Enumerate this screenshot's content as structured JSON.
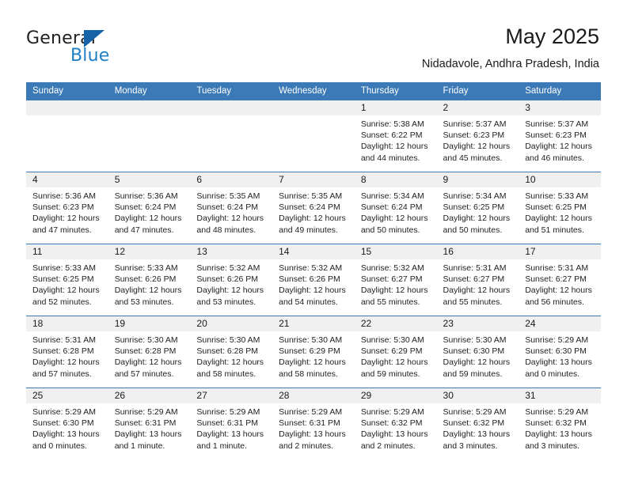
{
  "brand": {
    "line1": "General",
    "line2": "Blue",
    "icon": "triangle-logo"
  },
  "header": {
    "title": "May 2025",
    "subtitle": "Nidadavole, Andhra Pradesh, India"
  },
  "colors": {
    "header_blue": "#3b79b7",
    "brand_blue": "#1f7fc4",
    "daynum_band": "#f0f0f0",
    "text": "#1a1a1a"
  },
  "weekday_headers": [
    "Sunday",
    "Monday",
    "Tuesday",
    "Wednesday",
    "Thursday",
    "Friday",
    "Saturday"
  ],
  "labels": {
    "sunrise_prefix": "Sunrise: ",
    "sunset_prefix": "Sunset: ",
    "daylight_prefix": "Daylight: "
  },
  "weeks": [
    [
      {
        "day": "",
        "sunrise": "",
        "sunset": "",
        "daylight_line1": "",
        "daylight_line2": "",
        "empty": true
      },
      {
        "day": "",
        "sunrise": "",
        "sunset": "",
        "daylight_line1": "",
        "daylight_line2": "",
        "empty": true
      },
      {
        "day": "",
        "sunrise": "",
        "sunset": "",
        "daylight_line1": "",
        "daylight_line2": "",
        "empty": true
      },
      {
        "day": "",
        "sunrise": "",
        "sunset": "",
        "daylight_line1": "",
        "daylight_line2": "",
        "empty": true
      },
      {
        "day": "1",
        "sunrise": "Sunrise: 5:38 AM",
        "sunset": "Sunset: 6:22 PM",
        "daylight_line1": "Daylight: 12 hours",
        "daylight_line2": "and 44 minutes."
      },
      {
        "day": "2",
        "sunrise": "Sunrise: 5:37 AM",
        "sunset": "Sunset: 6:23 PM",
        "daylight_line1": "Daylight: 12 hours",
        "daylight_line2": "and 45 minutes."
      },
      {
        "day": "3",
        "sunrise": "Sunrise: 5:37 AM",
        "sunset": "Sunset: 6:23 PM",
        "daylight_line1": "Daylight: 12 hours",
        "daylight_line2": "and 46 minutes."
      }
    ],
    [
      {
        "day": "4",
        "sunrise": "Sunrise: 5:36 AM",
        "sunset": "Sunset: 6:23 PM",
        "daylight_line1": "Daylight: 12 hours",
        "daylight_line2": "and 47 minutes."
      },
      {
        "day": "5",
        "sunrise": "Sunrise: 5:36 AM",
        "sunset": "Sunset: 6:24 PM",
        "daylight_line1": "Daylight: 12 hours",
        "daylight_line2": "and 47 minutes."
      },
      {
        "day": "6",
        "sunrise": "Sunrise: 5:35 AM",
        "sunset": "Sunset: 6:24 PM",
        "daylight_line1": "Daylight: 12 hours",
        "daylight_line2": "and 48 minutes."
      },
      {
        "day": "7",
        "sunrise": "Sunrise: 5:35 AM",
        "sunset": "Sunset: 6:24 PM",
        "daylight_line1": "Daylight: 12 hours",
        "daylight_line2": "and 49 minutes."
      },
      {
        "day": "8",
        "sunrise": "Sunrise: 5:34 AM",
        "sunset": "Sunset: 6:24 PM",
        "daylight_line1": "Daylight: 12 hours",
        "daylight_line2": "and 50 minutes."
      },
      {
        "day": "9",
        "sunrise": "Sunrise: 5:34 AM",
        "sunset": "Sunset: 6:25 PM",
        "daylight_line1": "Daylight: 12 hours",
        "daylight_line2": "and 50 minutes."
      },
      {
        "day": "10",
        "sunrise": "Sunrise: 5:33 AM",
        "sunset": "Sunset: 6:25 PM",
        "daylight_line1": "Daylight: 12 hours",
        "daylight_line2": "and 51 minutes."
      }
    ],
    [
      {
        "day": "11",
        "sunrise": "Sunrise: 5:33 AM",
        "sunset": "Sunset: 6:25 PM",
        "daylight_line1": "Daylight: 12 hours",
        "daylight_line2": "and 52 minutes."
      },
      {
        "day": "12",
        "sunrise": "Sunrise: 5:33 AM",
        "sunset": "Sunset: 6:26 PM",
        "daylight_line1": "Daylight: 12 hours",
        "daylight_line2": "and 53 minutes."
      },
      {
        "day": "13",
        "sunrise": "Sunrise: 5:32 AM",
        "sunset": "Sunset: 6:26 PM",
        "daylight_line1": "Daylight: 12 hours",
        "daylight_line2": "and 53 minutes."
      },
      {
        "day": "14",
        "sunrise": "Sunrise: 5:32 AM",
        "sunset": "Sunset: 6:26 PM",
        "daylight_line1": "Daylight: 12 hours",
        "daylight_line2": "and 54 minutes."
      },
      {
        "day": "15",
        "sunrise": "Sunrise: 5:32 AM",
        "sunset": "Sunset: 6:27 PM",
        "daylight_line1": "Daylight: 12 hours",
        "daylight_line2": "and 55 minutes."
      },
      {
        "day": "16",
        "sunrise": "Sunrise: 5:31 AM",
        "sunset": "Sunset: 6:27 PM",
        "daylight_line1": "Daylight: 12 hours",
        "daylight_line2": "and 55 minutes."
      },
      {
        "day": "17",
        "sunrise": "Sunrise: 5:31 AM",
        "sunset": "Sunset: 6:27 PM",
        "daylight_line1": "Daylight: 12 hours",
        "daylight_line2": "and 56 minutes."
      }
    ],
    [
      {
        "day": "18",
        "sunrise": "Sunrise: 5:31 AM",
        "sunset": "Sunset: 6:28 PM",
        "daylight_line1": "Daylight: 12 hours",
        "daylight_line2": "and 57 minutes."
      },
      {
        "day": "19",
        "sunrise": "Sunrise: 5:30 AM",
        "sunset": "Sunset: 6:28 PM",
        "daylight_line1": "Daylight: 12 hours",
        "daylight_line2": "and 57 minutes."
      },
      {
        "day": "20",
        "sunrise": "Sunrise: 5:30 AM",
        "sunset": "Sunset: 6:28 PM",
        "daylight_line1": "Daylight: 12 hours",
        "daylight_line2": "and 58 minutes."
      },
      {
        "day": "21",
        "sunrise": "Sunrise: 5:30 AM",
        "sunset": "Sunset: 6:29 PM",
        "daylight_line1": "Daylight: 12 hours",
        "daylight_line2": "and 58 minutes."
      },
      {
        "day": "22",
        "sunrise": "Sunrise: 5:30 AM",
        "sunset": "Sunset: 6:29 PM",
        "daylight_line1": "Daylight: 12 hours",
        "daylight_line2": "and 59 minutes."
      },
      {
        "day": "23",
        "sunrise": "Sunrise: 5:30 AM",
        "sunset": "Sunset: 6:30 PM",
        "daylight_line1": "Daylight: 12 hours",
        "daylight_line2": "and 59 minutes."
      },
      {
        "day": "24",
        "sunrise": "Sunrise: 5:29 AM",
        "sunset": "Sunset: 6:30 PM",
        "daylight_line1": "Daylight: 13 hours",
        "daylight_line2": "and 0 minutes."
      }
    ],
    [
      {
        "day": "25",
        "sunrise": "Sunrise: 5:29 AM",
        "sunset": "Sunset: 6:30 PM",
        "daylight_line1": "Daylight: 13 hours",
        "daylight_line2": "and 0 minutes."
      },
      {
        "day": "26",
        "sunrise": "Sunrise: 5:29 AM",
        "sunset": "Sunset: 6:31 PM",
        "daylight_line1": "Daylight: 13 hours",
        "daylight_line2": "and 1 minute."
      },
      {
        "day": "27",
        "sunrise": "Sunrise: 5:29 AM",
        "sunset": "Sunset: 6:31 PM",
        "daylight_line1": "Daylight: 13 hours",
        "daylight_line2": "and 1 minute."
      },
      {
        "day": "28",
        "sunrise": "Sunrise: 5:29 AM",
        "sunset": "Sunset: 6:31 PM",
        "daylight_line1": "Daylight: 13 hours",
        "daylight_line2": "and 2 minutes."
      },
      {
        "day": "29",
        "sunrise": "Sunrise: 5:29 AM",
        "sunset": "Sunset: 6:32 PM",
        "daylight_line1": "Daylight: 13 hours",
        "daylight_line2": "and 2 minutes."
      },
      {
        "day": "30",
        "sunrise": "Sunrise: 5:29 AM",
        "sunset": "Sunset: 6:32 PM",
        "daylight_line1": "Daylight: 13 hours",
        "daylight_line2": "and 3 minutes."
      },
      {
        "day": "31",
        "sunrise": "Sunrise: 5:29 AM",
        "sunset": "Sunset: 6:32 PM",
        "daylight_line1": "Daylight: 13 hours",
        "daylight_line2": "and 3 minutes."
      }
    ]
  ]
}
